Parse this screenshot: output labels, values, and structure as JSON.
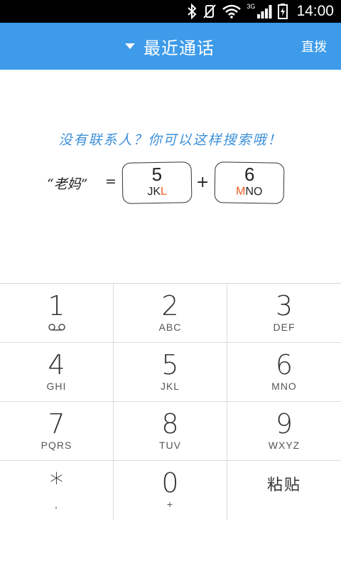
{
  "status_bar": {
    "network": "3G",
    "time": "14:00"
  },
  "header": {
    "title": "最近通话",
    "direct_dial": "直拨"
  },
  "hint": {
    "text": "没有联系人？你可以这样搜索哦！",
    "example_name": "“老妈”",
    "equals": "=",
    "plus": "+",
    "key1": {
      "digit": "5",
      "letters_plain": "JK",
      "letters_highlight": "L"
    },
    "key2": {
      "digit": "6",
      "letters_highlight": "M",
      "letters_plain": "NO"
    }
  },
  "dialpad": {
    "keys": [
      {
        "digit": "1",
        "letters": ""
      },
      {
        "digit": "2",
        "letters": "ABC"
      },
      {
        "digit": "3",
        "letters": "DEF"
      },
      {
        "digit": "4",
        "letters": "GHI"
      },
      {
        "digit": "5",
        "letters": "JKL"
      },
      {
        "digit": "6",
        "letters": "MNO"
      },
      {
        "digit": "7",
        "letters": "PQRS"
      },
      {
        "digit": "8",
        "letters": "TUV"
      },
      {
        "digit": "9",
        "letters": "WXYZ"
      },
      {
        "digit": "*",
        "letters": ","
      },
      {
        "digit": "0",
        "letters": "+"
      }
    ],
    "paste_label": "粘贴"
  },
  "colors": {
    "header_bg": "#3d9bea",
    "hint_text": "#3b8fd9",
    "highlight": "#ee5a1f"
  }
}
